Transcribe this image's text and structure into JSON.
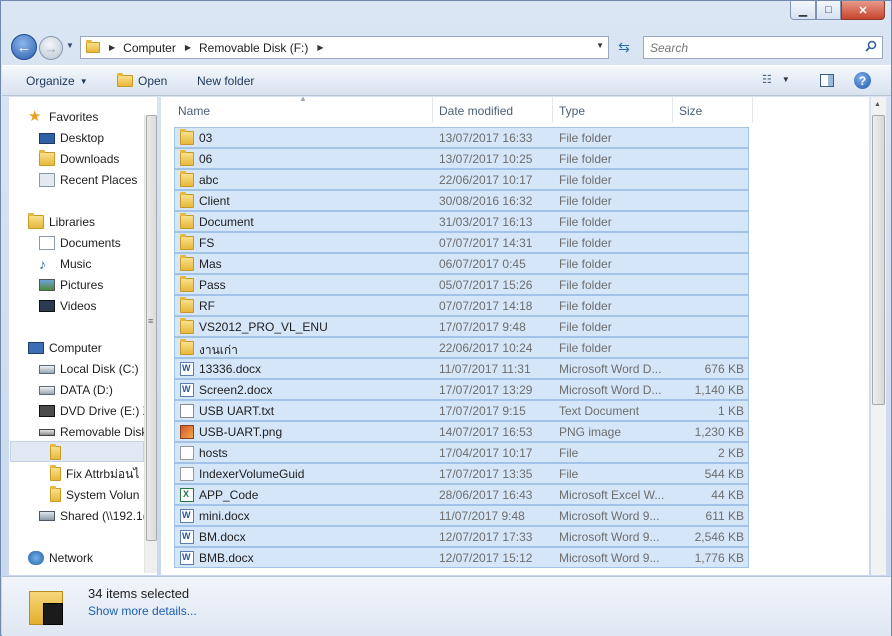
{
  "window": {
    "minimize_glyph": "▁",
    "maximize_glyph": "□",
    "close_glyph": "✕"
  },
  "nav": {
    "back_glyph": "←",
    "forward_glyph": "→",
    "breadcrumb": [
      "Computer",
      "Removable Disk (F:)"
    ],
    "search_placeholder": "Search"
  },
  "toolbar": {
    "organize": "Organize",
    "open": "Open",
    "new_folder": "New folder"
  },
  "sidebar": {
    "items": [
      {
        "label": "Favorites",
        "icon": "star-icon"
      },
      {
        "label": "Desktop",
        "icon": "desktop-icon"
      },
      {
        "label": "Downloads",
        "icon": "downloads-icon"
      },
      {
        "label": "Recent Places",
        "icon": "recent-places-icon"
      },
      {
        "label": "Libraries",
        "icon": "libraries-icon"
      },
      {
        "label": "Documents",
        "icon": "documents-icon"
      },
      {
        "label": "Music",
        "icon": "music-icon"
      },
      {
        "label": "Pictures",
        "icon": "pictures-icon"
      },
      {
        "label": "Videos",
        "icon": "videos-icon"
      },
      {
        "label": "Computer",
        "icon": "computer-icon"
      },
      {
        "label": "Local Disk (C:)",
        "icon": "drive-icon"
      },
      {
        "label": "DATA (D:)",
        "icon": "drive-icon"
      },
      {
        "label": "DVD Drive (E:) X",
        "icon": "dvd-icon"
      },
      {
        "label": "Removable Disk",
        "icon": "removable-disk-icon"
      },
      {
        "label": "",
        "icon": "folder-icon"
      },
      {
        "label": "Fix Attrbม่อนไ",
        "icon": "folder-icon"
      },
      {
        "label": "System Volun",
        "icon": "folder-icon"
      },
      {
        "label": "Shared (\\\\192.1(",
        "icon": "network-drive-icon"
      },
      {
        "label": "Network",
        "icon": "network-icon"
      }
    ]
  },
  "columns": {
    "name": "Name",
    "date": "Date modified",
    "type": "Type",
    "size": "Size"
  },
  "files": [
    {
      "name": "03",
      "date": "13/07/2017 16:33",
      "type": "File folder",
      "size": "",
      "icon": "folder"
    },
    {
      "name": "06",
      "date": "13/07/2017 10:25",
      "type": "File folder",
      "size": "",
      "icon": "folder"
    },
    {
      "name": "abc",
      "date": "22/06/2017 10:17",
      "type": "File folder",
      "size": "",
      "icon": "folder"
    },
    {
      "name": "Client",
      "date": "30/08/2016 16:32",
      "type": "File folder",
      "size": "",
      "icon": "folder"
    },
    {
      "name": "Document",
      "date": "31/03/2017 16:13",
      "type": "File folder",
      "size": "",
      "icon": "folder"
    },
    {
      "name": "FS",
      "date": "07/07/2017 14:31",
      "type": "File folder",
      "size": "",
      "icon": "folder"
    },
    {
      "name": "Mas",
      "date": "06/07/2017 0:45",
      "type": "File folder",
      "size": "",
      "icon": "folder"
    },
    {
      "name": "Pass",
      "date": "05/07/2017 15:26",
      "type": "File folder",
      "size": "",
      "icon": "folder"
    },
    {
      "name": "RF",
      "date": "07/07/2017 14:18",
      "type": "File folder",
      "size": "",
      "icon": "folder"
    },
    {
      "name": "VS2012_PRO_VL_ENU",
      "date": "17/07/2017 9:48",
      "type": "File folder",
      "size": "",
      "icon": "folder"
    },
    {
      "name": "งานเก่า",
      "date": "22/06/2017 10:24",
      "type": "File folder",
      "size": "",
      "icon": "folder"
    },
    {
      "name": "13336.docx",
      "date": "11/07/2017 11:31",
      "type": "Microsoft Word D...",
      "size": "676 KB",
      "icon": "docx"
    },
    {
      "name": "Screen2.docx",
      "date": "17/07/2017 13:29",
      "type": "Microsoft Word D...",
      "size": "1,140 KB",
      "icon": "docx"
    },
    {
      "name": "USB UART.txt",
      "date": "17/07/2017 9:15",
      "type": "Text Document",
      "size": "1 KB",
      "icon": "txt"
    },
    {
      "name": "USB-UART.png",
      "date": "14/07/2017 16:53",
      "type": "PNG image",
      "size": "1,230 KB",
      "icon": "png"
    },
    {
      "name": "hosts",
      "date": "17/04/2017 10:17",
      "type": "File",
      "size": "2 KB",
      "icon": "file"
    },
    {
      "name": "IndexerVolumeGuid",
      "date": "17/07/2017 13:35",
      "type": "File",
      "size": "544 KB",
      "icon": "file"
    },
    {
      "name": "APP_Code",
      "date": "28/06/2017 16:43",
      "type": "Microsoft Excel W...",
      "size": "44 KB",
      "icon": "xls"
    },
    {
      "name": "mini.docx",
      "date": "11/07/2017 9:48",
      "type": "Microsoft Word 9...",
      "size": "611 KB",
      "icon": "docx"
    },
    {
      "name": "BM.docx",
      "date": "12/07/2017 17:33",
      "type": "Microsoft Word 9...",
      "size": "2,546 KB",
      "icon": "docx"
    },
    {
      "name": "BMB.docx",
      "date": "12/07/2017 15:12",
      "type": "Microsoft Word 9...",
      "size": "1,776 KB",
      "icon": "docx"
    }
  ],
  "details": {
    "title": "34 items selected",
    "more": "Show more details..."
  },
  "colors": {
    "selection_fill": "#d5e6f9",
    "selection_border": "#a2c3e7",
    "link": "#1c5fae"
  }
}
